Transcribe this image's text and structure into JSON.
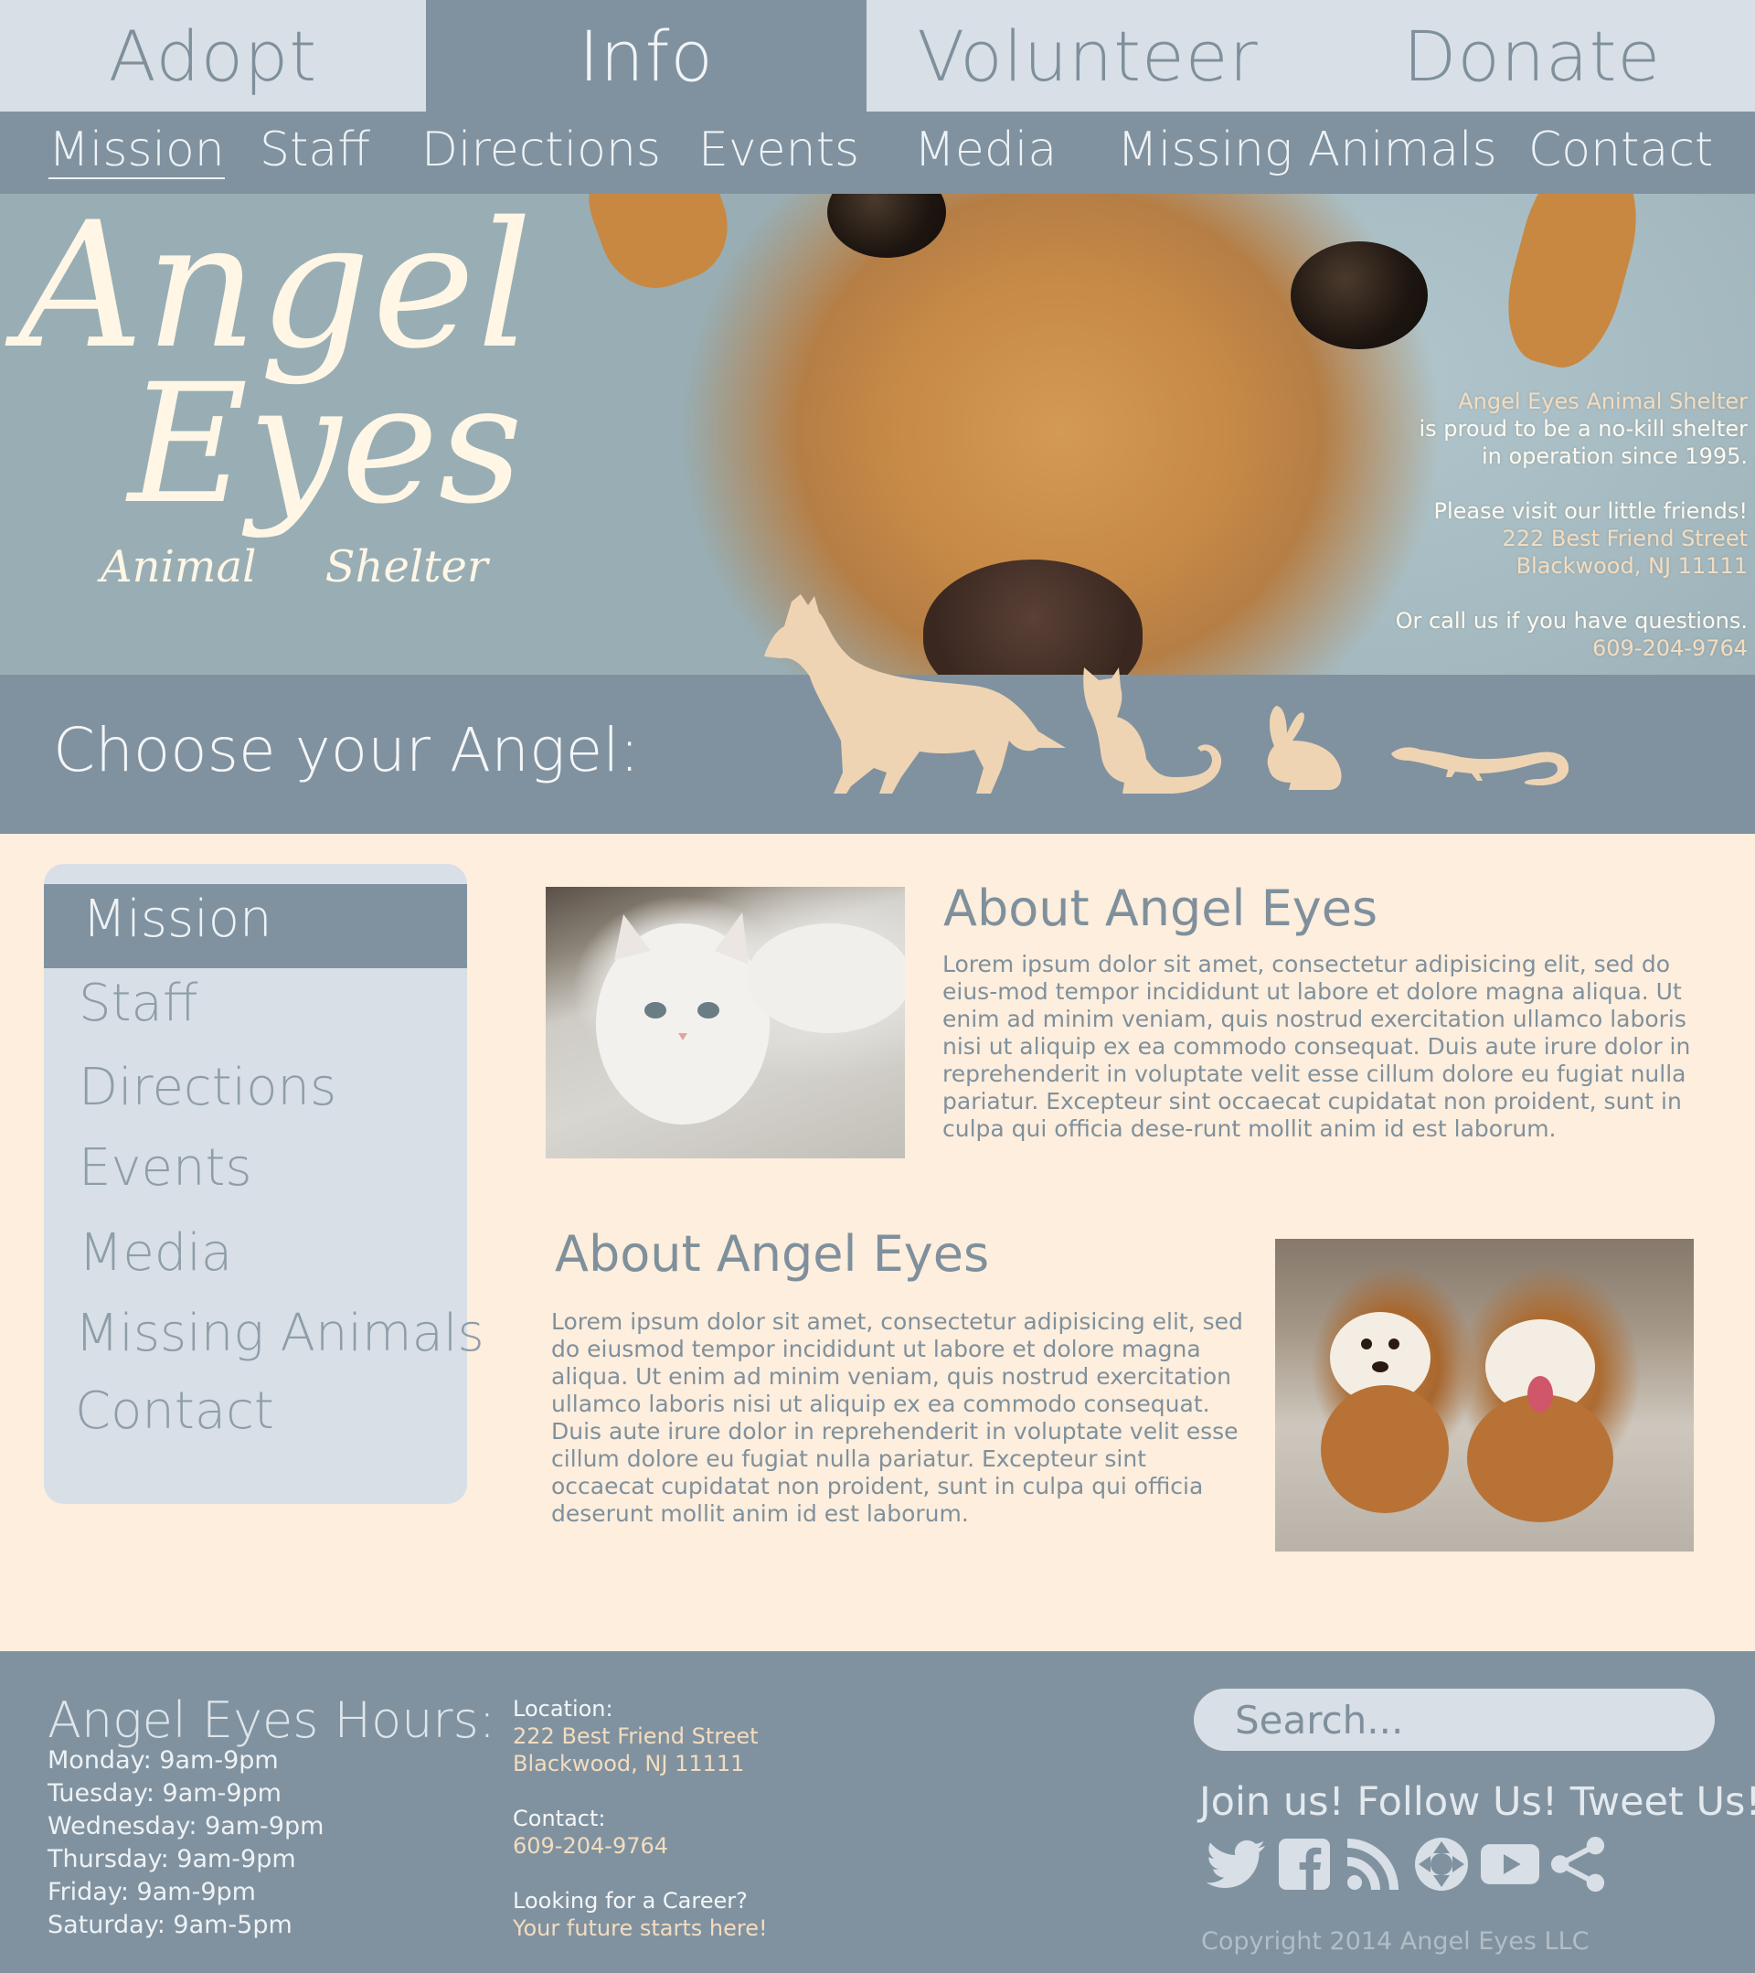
{
  "topnav": {
    "tabs": [
      {
        "label": "Adopt",
        "active": false
      },
      {
        "label": "Info",
        "active": true
      },
      {
        "label": "Volunteer",
        "active": false
      },
      {
        "label": "Donate",
        "active": false
      }
    ]
  },
  "subnav": {
    "items": [
      {
        "label": "Mission",
        "active": true
      },
      {
        "label": "Staff"
      },
      {
        "label": "Directions"
      },
      {
        "label": "Events"
      },
      {
        "label": "Media"
      },
      {
        "label": "Missing Animals"
      },
      {
        "label": "Contact"
      }
    ]
  },
  "hero": {
    "logo": {
      "line1": "Angel",
      "line2": "Eyes",
      "sub": "Animal Shelter"
    },
    "info": {
      "line1": "Angel Eyes Animal Shelter",
      "line2": "is proud to be a no-kill shelter",
      "line3": "in operation since 1995.",
      "line4": "Please visit our little friends!",
      "address1": "222 Best Friend Street",
      "address2": "Blackwood, NJ 11111",
      "line5": "Or call us if you have questions.",
      "phone": "609-204-9764"
    }
  },
  "choose": {
    "label": "Choose your Angel:",
    "animals": [
      "dog-icon",
      "cat-icon",
      "rabbit-icon",
      "lizard-icon"
    ]
  },
  "sidebar": {
    "items": [
      {
        "label": "Mission",
        "active": true
      },
      {
        "label": "Staff"
      },
      {
        "label": "Directions"
      },
      {
        "label": "Events"
      },
      {
        "label": "Media"
      },
      {
        "label": "Missing Animals"
      },
      {
        "label": "Contact"
      }
    ]
  },
  "content": {
    "section1": {
      "title": "About Angel Eyes",
      "text": "Lorem ipsum dolor sit amet, consectetur adipisicing elit, sed do eius-mod tempor incididunt ut labore et dolore magna aliqua. Ut enim ad minim veniam, quis nostrud exercitation ullamco laboris nisi ut aliquip ex ea commodo consequat. Duis aute irure dolor in reprehenderit in voluptate velit esse cillum dolore eu fugiat nulla pariatur. Excepteur sint occaecat cupidatat non proident, sunt in culpa qui officia dese-runt mollit anim id est laborum."
    },
    "section2": {
      "title": "About Angel Eyes",
      "text": "Lorem ipsum dolor sit amet, consectetur adipisicing elit, sed do eiusmod tempor incididunt ut labore et dolore magna aliqua. Ut enim ad minim veniam, quis nostrud exercitation ullamco laboris nisi ut aliquip ex ea commodo consequat. Duis aute irure dolor in reprehenderit in voluptate velit esse cillum dolore eu fugiat nulla pariatur. Excepteur sint occaecat cupidatat non proident, sunt in culpa qui officia deserunt mollit anim id est laborum."
    }
  },
  "footer": {
    "hours_title": "Angel Eyes Hours:",
    "hours": [
      "Monday: 9am-9pm",
      "Tuesday: 9am-9pm",
      "Wednesday: 9am-9pm",
      "Thursday: 9am-9pm",
      "Friday: 9am-9pm",
      "Saturday: 9am-5pm"
    ],
    "location_label": "Location:",
    "location1": "222 Best Friend Street",
    "location2": "Blackwood, NJ 11111",
    "contact_label": "Contact:",
    "contact_phone": "609-204-9764",
    "career_label": "Looking for a Career?",
    "career_link": "Your future starts here!",
    "search_placeholder": "Search...",
    "join": "Join us! Follow Us! Tweet Us!",
    "social": [
      "twitter-icon",
      "facebook-icon",
      "rss-icon",
      "camera-icon",
      "youtube-icon",
      "share-icon"
    ],
    "copyright": "Copyright 2014 Angel Eyes LLC"
  },
  "colors": {
    "slate": "#80929f",
    "light_slate": "#d8dfe6",
    "cream": "#fdeedd",
    "tan": "#efd4b4",
    "highlight": "#f3dcc0"
  }
}
